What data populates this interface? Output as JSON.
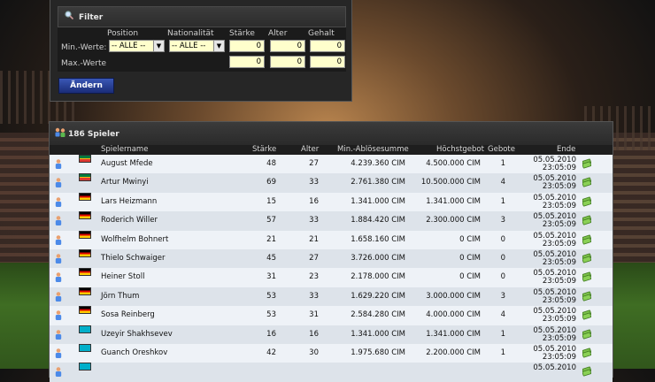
{
  "filter": {
    "title": "Filter",
    "columns": {
      "position": "Position",
      "nationality": "Nationalität",
      "strength": "Stärke",
      "age": "Alter",
      "salary": "Gehalt"
    },
    "min_label": "Min.-Werte:",
    "max_label": "Max.-Werte",
    "position_value": "-- ALLE --",
    "nationality_value": "-- ALLE --",
    "min": {
      "strength": "0",
      "age": "0",
      "salary": "0"
    },
    "max": {
      "strength": "0",
      "age": "0",
      "salary": "0"
    },
    "apply_button": "Ändern"
  },
  "list": {
    "title": "186 Spieler",
    "headers": {
      "name": "Spielername",
      "strength": "Stärke",
      "age": "Alter",
      "min_fee": "Min.-Ablösesumme",
      "highest_bid": "Höchstgebot",
      "bids": "Gebote",
      "end": "Ende"
    },
    "rows": [
      {
        "flag": "za",
        "name": "August Mfede",
        "strength": "48",
        "age": "27",
        "min_fee": "4.239.360 CIM",
        "highest_bid": "4.500.000 CIM",
        "bids": "1",
        "end_date": "05.05.2010",
        "end_time": "23:05:09"
      },
      {
        "flag": "za",
        "name": "Artur Mwinyi",
        "strength": "69",
        "age": "33",
        "min_fee": "2.761.380 CIM",
        "highest_bid": "10.500.000 CIM",
        "bids": "4",
        "end_date": "05.05.2010",
        "end_time": "23:05:09"
      },
      {
        "flag": "de",
        "name": "Lars Heizmann",
        "strength": "15",
        "age": "16",
        "min_fee": "1.341.000 CIM",
        "highest_bid": "1.341.000 CIM",
        "bids": "1",
        "end_date": "05.05.2010",
        "end_time": "23:05:09"
      },
      {
        "flag": "de",
        "name": "Roderich Willer",
        "strength": "57",
        "age": "33",
        "min_fee": "1.884.420 CIM",
        "highest_bid": "2.300.000 CIM",
        "bids": "3",
        "end_date": "05.05.2010",
        "end_time": "23:05:09"
      },
      {
        "flag": "de",
        "name": "Wolfhelm Bohnert",
        "strength": "21",
        "age": "21",
        "min_fee": "1.658.160 CIM",
        "highest_bid": "0 CIM",
        "bids": "0",
        "end_date": "05.05.2010",
        "end_time": "23:05:09"
      },
      {
        "flag": "de",
        "name": "Thielo Schwaiger",
        "strength": "45",
        "age": "27",
        "min_fee": "3.726.000 CIM",
        "highest_bid": "0 CIM",
        "bids": "0",
        "end_date": "05.05.2010",
        "end_time": "23:05:09"
      },
      {
        "flag": "de",
        "name": "Heiner Stoll",
        "strength": "31",
        "age": "23",
        "min_fee": "2.178.000 CIM",
        "highest_bid": "0 CIM",
        "bids": "0",
        "end_date": "05.05.2010",
        "end_time": "23:05:09"
      },
      {
        "flag": "de",
        "name": "Jörn Thum",
        "strength": "53",
        "age": "33",
        "min_fee": "1.629.220 CIM",
        "highest_bid": "3.000.000 CIM",
        "bids": "3",
        "end_date": "05.05.2010",
        "end_time": "23:05:09"
      },
      {
        "flag": "de",
        "name": "Sosa Reinberg",
        "strength": "53",
        "age": "31",
        "min_fee": "2.584.280 CIM",
        "highest_bid": "4.000.000 CIM",
        "bids": "4",
        "end_date": "05.05.2010",
        "end_time": "23:05:09"
      },
      {
        "flag": "kz",
        "name": "Uzeyir Shakhsevev",
        "strength": "16",
        "age": "16",
        "min_fee": "1.341.000 CIM",
        "highest_bid": "1.341.000 CIM",
        "bids": "1",
        "end_date": "05.05.2010",
        "end_time": "23:05:09"
      },
      {
        "flag": "kz",
        "name": "Guanch Oreshkov",
        "strength": "42",
        "age": "30",
        "min_fee": "1.975.680 CIM",
        "highest_bid": "2.200.000 CIM",
        "bids": "1",
        "end_date": "05.05.2010",
        "end_time": "23:05:09"
      },
      {
        "flag": "kz",
        "name": "",
        "strength": "",
        "age": "",
        "min_fee": "",
        "highest_bid": "",
        "bids": "",
        "end_date": "05.05.2010",
        "end_time": ""
      }
    ]
  },
  "colors": {
    "input_bg": "#ffffcc",
    "button_blue": "#2a44a0",
    "row_light": "#eef2f7",
    "row_dark": "#dde3ea"
  }
}
